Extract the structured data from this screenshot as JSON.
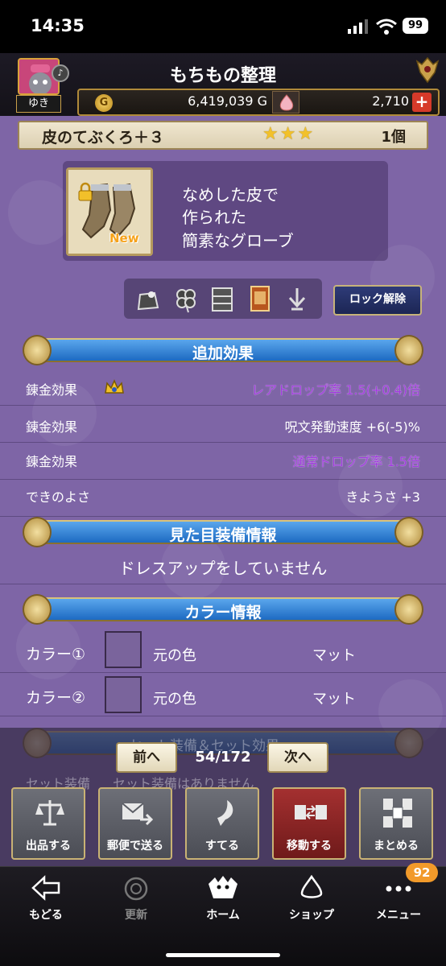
{
  "status_bar": {
    "time": "14:35",
    "battery": "99"
  },
  "header": {
    "title": "もちもの整理",
    "avatar_name": "ゆき",
    "gold": "6,419,039 G",
    "gold_icon": "G",
    "gems": "2,710",
    "add_symbol": "+"
  },
  "item": {
    "name": "皮のてぶくろ＋３",
    "stars": "★★★",
    "count": "1個",
    "new_label": "New",
    "description": [
      "なめした皮で",
      "作られた",
      "簡素なグローブ"
    ],
    "unlock_label": "ロック解除"
  },
  "sections": {
    "extra_effects": "追加効果",
    "appearance": "見た目装備情報",
    "color_info": "カラー情報",
    "set_effects": "セット装備＆セット効果"
  },
  "effects": [
    {
      "label": "錬金効果",
      "value": "レアドロップ率 1.5(+0.4)倍",
      "highlight": true
    },
    {
      "label": "錬金効果",
      "value": "呪文発動速度 +6(-5)%",
      "highlight": false
    },
    {
      "label": "錬金効果",
      "value": "通常ドロップ率 1.5倍",
      "highlight": true
    },
    {
      "label": "できのよさ",
      "value": "きようさ +3",
      "highlight": false
    }
  ],
  "dressup_text": "ドレスアップをしていません",
  "colors": [
    {
      "label": "カラー①",
      "original": "元の色",
      "finish": "マット"
    },
    {
      "label": "カラー②",
      "original": "元の色",
      "finish": "マット"
    }
  ],
  "set_row": {
    "label": "セット装備",
    "value": "セット装備はありません"
  },
  "pager": {
    "prev": "前へ",
    "next": "次へ",
    "position": "54/172"
  },
  "actions": [
    {
      "label": "出品する",
      "icon": "scale-icon"
    },
    {
      "label": "郵便で送る",
      "icon": "mail-send-icon"
    },
    {
      "label": "すてる",
      "icon": "discard-icon"
    },
    {
      "label": "移動する",
      "icon": "move-icon"
    },
    {
      "label": "まとめる",
      "icon": "bundle-icon"
    }
  ],
  "tabs": [
    {
      "label": "もどる",
      "icon": "back-arrow-icon"
    },
    {
      "label": "更新",
      "icon": "refresh-icon"
    },
    {
      "label": "ホーム",
      "icon": "home-icon"
    },
    {
      "label": "ショップ",
      "icon": "shop-icon"
    },
    {
      "label": "メニュー",
      "icon": "menu-icon"
    }
  ],
  "menu_badge": "92"
}
